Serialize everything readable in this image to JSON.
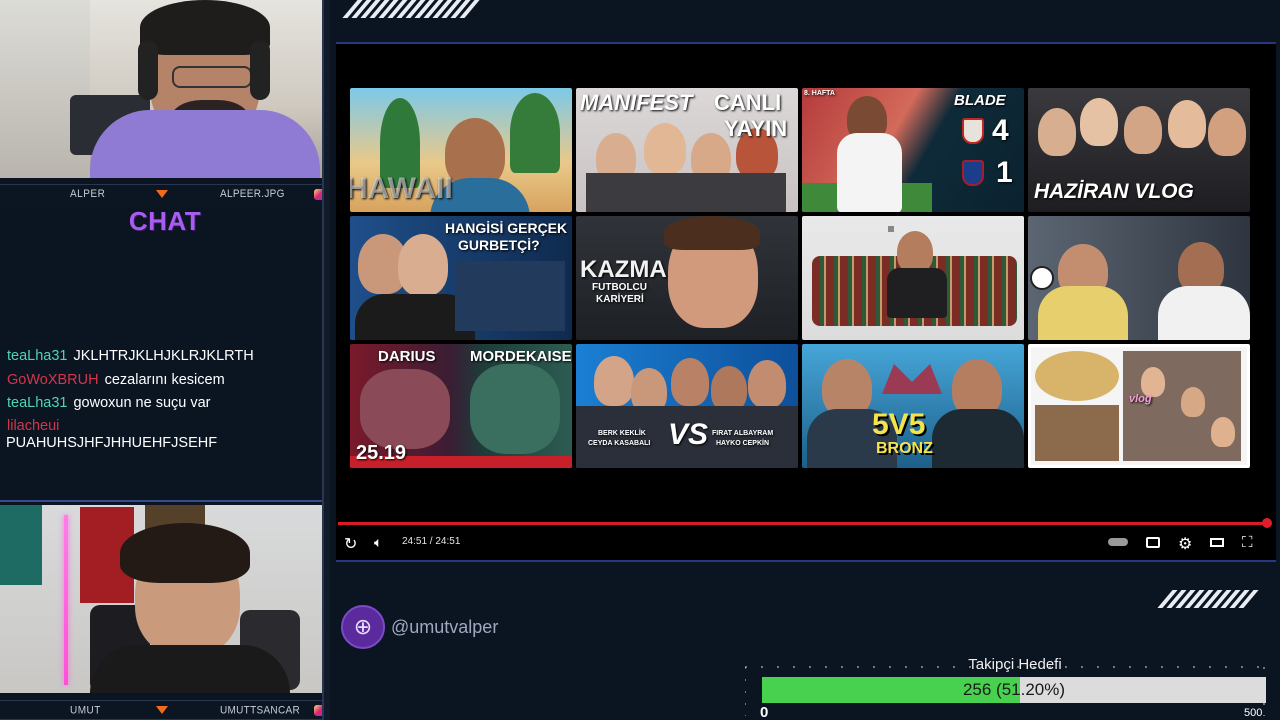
{
  "webcams": {
    "top": {
      "name_left": "ALPER",
      "name_right": "ALPEER.JPG"
    },
    "bottom": {
      "name_left": "UMUT",
      "name_right": "UMUTTSANCAR"
    }
  },
  "chat": {
    "title": "CHAT",
    "messages": [
      {
        "user": "teaLha31",
        "user_color": "#4fd4b4",
        "text": "JKLHTRJKLHJKLRJKLRTH"
      },
      {
        "user": "GoWoXBRUH",
        "user_color": "#d2364b",
        "text": "cezalarını kesicem"
      },
      {
        "user": "teaLha31",
        "user_color": "#4fd4b4",
        "text": "gowoxun ne suçu var"
      },
      {
        "user": "lilacheui",
        "user_color": "#d2364b",
        "text": "PUAHUHSJHFJHHUEHFJSEHF"
      }
    ]
  },
  "video": {
    "thumbnails": [
      {
        "id": "hawaii",
        "caption": "HAWAII"
      },
      {
        "id": "manifest",
        "caption": "MANIFEST",
        "caption2": "CANLI",
        "caption3": "YAYIN"
      },
      {
        "id": "blade",
        "caption": "BLADE",
        "score1": "4",
        "score2": "1",
        "small": "8. HAFTA"
      },
      {
        "id": "haziran",
        "caption": "HAZİRAN VLOG"
      },
      {
        "id": "gurbetci",
        "caption": "HANGİSİ GERÇEK",
        "caption2": "GURBETÇİ?"
      },
      {
        "id": "kazma",
        "caption": "KAZMA",
        "caption2": "FUTBOLCU",
        "caption3": "KARİYERİ"
      },
      {
        "id": "couch",
        "caption": ""
      },
      {
        "id": "fan",
        "caption": ""
      },
      {
        "id": "darius",
        "caption": "DARIUS",
        "caption2": "MORDEKAISER",
        "caption3": "25.19"
      },
      {
        "id": "vs",
        "caption": "BERK KEKLİK",
        "caption2": "CEYDA KASABALI",
        "caption3": "VS",
        "caption4": "FIRAT ALBAYRAM",
        "caption5": "HAYKO CEPKİN"
      },
      {
        "id": "bronz",
        "caption": "5V5",
        "caption2": "BRONZ"
      },
      {
        "id": "vlog2",
        "caption": "vlog"
      }
    ],
    "timecode": "24:51 / 24:51",
    "progress_fraction": 1.0
  },
  "social": {
    "handle": "@umutvalper"
  },
  "follower_goal": {
    "title": "Takipçi Hedefi",
    "label": "256 (51.20%)",
    "current": 256,
    "min": "0",
    "max": "500",
    "fraction": 0.512
  },
  "colors": {
    "accent": "#a85cf0",
    "progress": "#d91b28",
    "goal_fill": "#47d14e"
  }
}
